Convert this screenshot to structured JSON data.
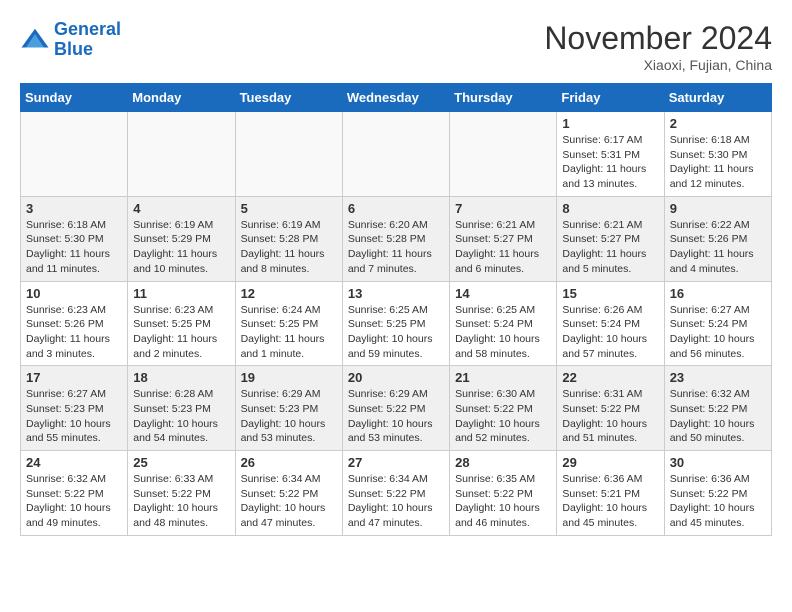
{
  "header": {
    "logo_line1": "General",
    "logo_line2": "Blue",
    "month_title": "November 2024",
    "location": "Xiaoxi, Fujian, China"
  },
  "days_of_week": [
    "Sunday",
    "Monday",
    "Tuesday",
    "Wednesday",
    "Thursday",
    "Friday",
    "Saturday"
  ],
  "weeks": [
    [
      {
        "day": "",
        "info": ""
      },
      {
        "day": "",
        "info": ""
      },
      {
        "day": "",
        "info": ""
      },
      {
        "day": "",
        "info": ""
      },
      {
        "day": "",
        "info": ""
      },
      {
        "day": "1",
        "info": "Sunrise: 6:17 AM\nSunset: 5:31 PM\nDaylight: 11 hours and 13 minutes."
      },
      {
        "day": "2",
        "info": "Sunrise: 6:18 AM\nSunset: 5:30 PM\nDaylight: 11 hours and 12 minutes."
      }
    ],
    [
      {
        "day": "3",
        "info": "Sunrise: 6:18 AM\nSunset: 5:30 PM\nDaylight: 11 hours and 11 minutes."
      },
      {
        "day": "4",
        "info": "Sunrise: 6:19 AM\nSunset: 5:29 PM\nDaylight: 11 hours and 10 minutes."
      },
      {
        "day": "5",
        "info": "Sunrise: 6:19 AM\nSunset: 5:28 PM\nDaylight: 11 hours and 8 minutes."
      },
      {
        "day": "6",
        "info": "Sunrise: 6:20 AM\nSunset: 5:28 PM\nDaylight: 11 hours and 7 minutes."
      },
      {
        "day": "7",
        "info": "Sunrise: 6:21 AM\nSunset: 5:27 PM\nDaylight: 11 hours and 6 minutes."
      },
      {
        "day": "8",
        "info": "Sunrise: 6:21 AM\nSunset: 5:27 PM\nDaylight: 11 hours and 5 minutes."
      },
      {
        "day": "9",
        "info": "Sunrise: 6:22 AM\nSunset: 5:26 PM\nDaylight: 11 hours and 4 minutes."
      }
    ],
    [
      {
        "day": "10",
        "info": "Sunrise: 6:23 AM\nSunset: 5:26 PM\nDaylight: 11 hours and 3 minutes."
      },
      {
        "day": "11",
        "info": "Sunrise: 6:23 AM\nSunset: 5:25 PM\nDaylight: 11 hours and 2 minutes."
      },
      {
        "day": "12",
        "info": "Sunrise: 6:24 AM\nSunset: 5:25 PM\nDaylight: 11 hours and 1 minute."
      },
      {
        "day": "13",
        "info": "Sunrise: 6:25 AM\nSunset: 5:25 PM\nDaylight: 10 hours and 59 minutes."
      },
      {
        "day": "14",
        "info": "Sunrise: 6:25 AM\nSunset: 5:24 PM\nDaylight: 10 hours and 58 minutes."
      },
      {
        "day": "15",
        "info": "Sunrise: 6:26 AM\nSunset: 5:24 PM\nDaylight: 10 hours and 57 minutes."
      },
      {
        "day": "16",
        "info": "Sunrise: 6:27 AM\nSunset: 5:24 PM\nDaylight: 10 hours and 56 minutes."
      }
    ],
    [
      {
        "day": "17",
        "info": "Sunrise: 6:27 AM\nSunset: 5:23 PM\nDaylight: 10 hours and 55 minutes."
      },
      {
        "day": "18",
        "info": "Sunrise: 6:28 AM\nSunset: 5:23 PM\nDaylight: 10 hours and 54 minutes."
      },
      {
        "day": "19",
        "info": "Sunrise: 6:29 AM\nSunset: 5:23 PM\nDaylight: 10 hours and 53 minutes."
      },
      {
        "day": "20",
        "info": "Sunrise: 6:29 AM\nSunset: 5:22 PM\nDaylight: 10 hours and 53 minutes."
      },
      {
        "day": "21",
        "info": "Sunrise: 6:30 AM\nSunset: 5:22 PM\nDaylight: 10 hours and 52 minutes."
      },
      {
        "day": "22",
        "info": "Sunrise: 6:31 AM\nSunset: 5:22 PM\nDaylight: 10 hours and 51 minutes."
      },
      {
        "day": "23",
        "info": "Sunrise: 6:32 AM\nSunset: 5:22 PM\nDaylight: 10 hours and 50 minutes."
      }
    ],
    [
      {
        "day": "24",
        "info": "Sunrise: 6:32 AM\nSunset: 5:22 PM\nDaylight: 10 hours and 49 minutes."
      },
      {
        "day": "25",
        "info": "Sunrise: 6:33 AM\nSunset: 5:22 PM\nDaylight: 10 hours and 48 minutes."
      },
      {
        "day": "26",
        "info": "Sunrise: 6:34 AM\nSunset: 5:22 PM\nDaylight: 10 hours and 47 minutes."
      },
      {
        "day": "27",
        "info": "Sunrise: 6:34 AM\nSunset: 5:22 PM\nDaylight: 10 hours and 47 minutes."
      },
      {
        "day": "28",
        "info": "Sunrise: 6:35 AM\nSunset: 5:22 PM\nDaylight: 10 hours and 46 minutes."
      },
      {
        "day": "29",
        "info": "Sunrise: 6:36 AM\nSunset: 5:21 PM\nDaylight: 10 hours and 45 minutes."
      },
      {
        "day": "30",
        "info": "Sunrise: 6:36 AM\nSunset: 5:22 PM\nDaylight: 10 hours and 45 minutes."
      }
    ]
  ]
}
